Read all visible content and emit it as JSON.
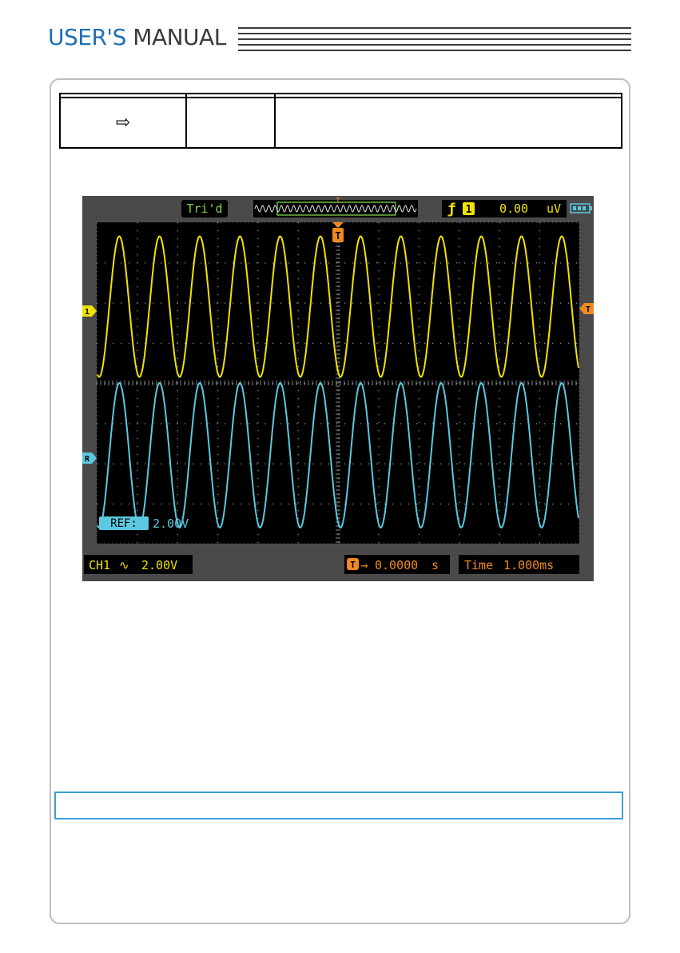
{
  "header": {
    "brand_part1": "USER'S",
    "brand_part2": "MANUAL"
  },
  "table": {
    "rows": [
      [
        "",
        "",
        ""
      ],
      [
        "",
        "",
        ""
      ]
    ],
    "arrow_icon": "right-arrow-icon"
  },
  "scope": {
    "trigger_status": "Tri'd",
    "trigger_info": {
      "edge_icon": "rising-edge-icon",
      "source": "1",
      "level": "0.00",
      "unit": "uV"
    },
    "battery_icon": "battery-icon",
    "markers": {
      "ch1": "1",
      "ref": "R",
      "trigger_level": "T",
      "trigger_pos": "T",
      "memory_top": "T"
    },
    "ref_label": "REF:",
    "ref_scale": "2.00V",
    "ch1_label": "CH1",
    "ch1_coupling_icon": "ac-coupling-icon",
    "ch1_scale": "2.00V",
    "trigger_offset_icon": "trigger-arrow-icon",
    "trigger_offset": "0.0000",
    "trigger_offset_unit": "s",
    "time_label": "Time",
    "timebase": "1.000ms",
    "colors": {
      "ch1": "#f2e200",
      "ref": "#5ac8e0",
      "status": "#7cd44a",
      "orange": "#f08a20",
      "bezel": "#4a4a4a",
      "screen": "#000000"
    },
    "chart_data": {
      "type": "line",
      "series": [
        {
          "waveform": "sine",
          "cycles_on_screen": 12,
          "volts_per_div": 2.0
        },
        {
          "waveform": "sine",
          "cycles_on_screen": 12,
          "volts_per_div": 2.0
        }
      ],
      "time_per_div_ms": 1.0,
      "divisions_x": 12,
      "divisions_y": 8,
      "grid": true
    }
  },
  "note": {
    "text": ""
  }
}
